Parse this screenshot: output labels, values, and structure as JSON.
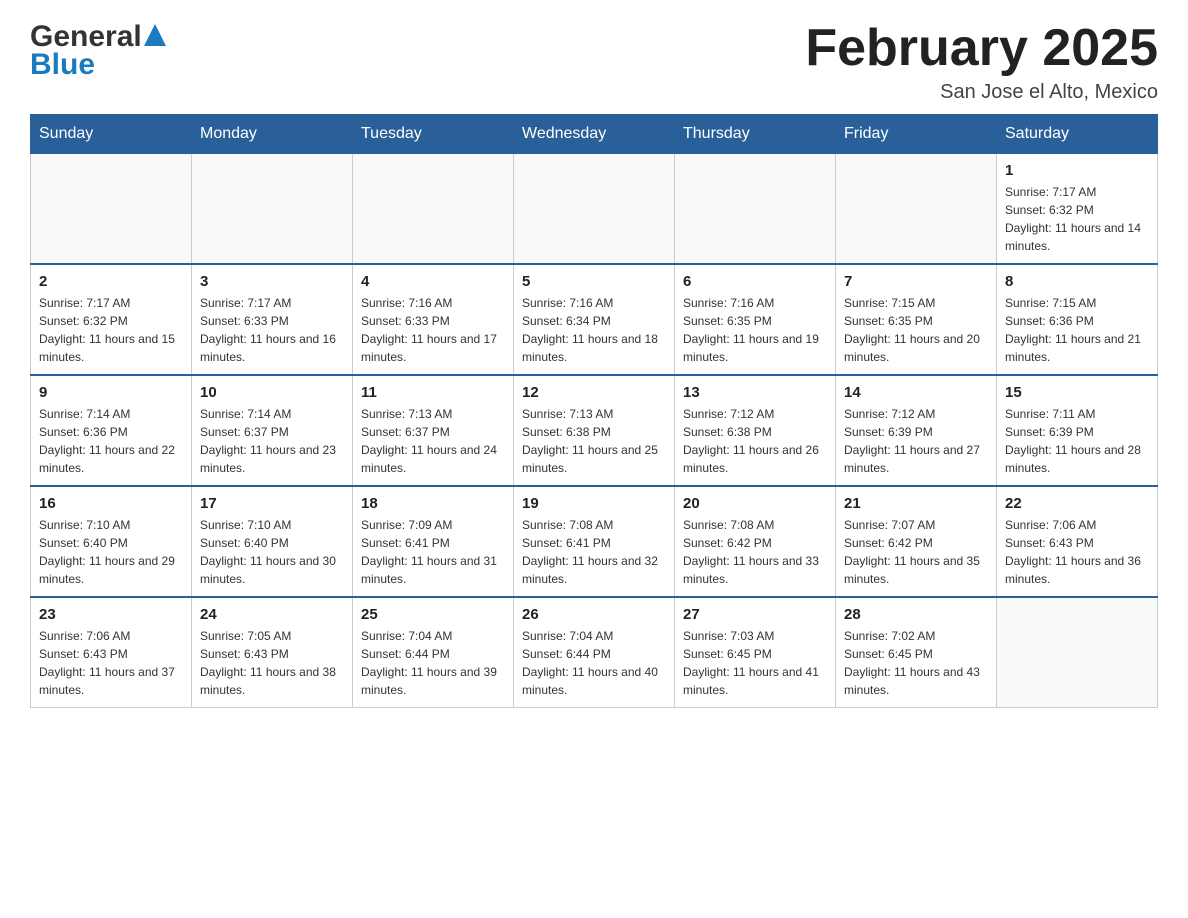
{
  "header": {
    "logo_general": "General",
    "logo_blue": "Blue",
    "month_title": "February 2025",
    "location": "San Jose el Alto, Mexico"
  },
  "weekdays": [
    "Sunday",
    "Monday",
    "Tuesday",
    "Wednesday",
    "Thursday",
    "Friday",
    "Saturday"
  ],
  "weeks": [
    [
      {
        "day": "",
        "sunrise": "",
        "sunset": "",
        "daylight": ""
      },
      {
        "day": "",
        "sunrise": "",
        "sunset": "",
        "daylight": ""
      },
      {
        "day": "",
        "sunrise": "",
        "sunset": "",
        "daylight": ""
      },
      {
        "day": "",
        "sunrise": "",
        "sunset": "",
        "daylight": ""
      },
      {
        "day": "",
        "sunrise": "",
        "sunset": "",
        "daylight": ""
      },
      {
        "day": "",
        "sunrise": "",
        "sunset": "",
        "daylight": ""
      },
      {
        "day": "1",
        "sunrise": "Sunrise: 7:17 AM",
        "sunset": "Sunset: 6:32 PM",
        "daylight": "Daylight: 11 hours and 14 minutes."
      }
    ],
    [
      {
        "day": "2",
        "sunrise": "Sunrise: 7:17 AM",
        "sunset": "Sunset: 6:32 PM",
        "daylight": "Daylight: 11 hours and 15 minutes."
      },
      {
        "day": "3",
        "sunrise": "Sunrise: 7:17 AM",
        "sunset": "Sunset: 6:33 PM",
        "daylight": "Daylight: 11 hours and 16 minutes."
      },
      {
        "day": "4",
        "sunrise": "Sunrise: 7:16 AM",
        "sunset": "Sunset: 6:33 PM",
        "daylight": "Daylight: 11 hours and 17 minutes."
      },
      {
        "day": "5",
        "sunrise": "Sunrise: 7:16 AM",
        "sunset": "Sunset: 6:34 PM",
        "daylight": "Daylight: 11 hours and 18 minutes."
      },
      {
        "day": "6",
        "sunrise": "Sunrise: 7:16 AM",
        "sunset": "Sunset: 6:35 PM",
        "daylight": "Daylight: 11 hours and 19 minutes."
      },
      {
        "day": "7",
        "sunrise": "Sunrise: 7:15 AM",
        "sunset": "Sunset: 6:35 PM",
        "daylight": "Daylight: 11 hours and 20 minutes."
      },
      {
        "day": "8",
        "sunrise": "Sunrise: 7:15 AM",
        "sunset": "Sunset: 6:36 PM",
        "daylight": "Daylight: 11 hours and 21 minutes."
      }
    ],
    [
      {
        "day": "9",
        "sunrise": "Sunrise: 7:14 AM",
        "sunset": "Sunset: 6:36 PM",
        "daylight": "Daylight: 11 hours and 22 minutes."
      },
      {
        "day": "10",
        "sunrise": "Sunrise: 7:14 AM",
        "sunset": "Sunset: 6:37 PM",
        "daylight": "Daylight: 11 hours and 23 minutes."
      },
      {
        "day": "11",
        "sunrise": "Sunrise: 7:13 AM",
        "sunset": "Sunset: 6:37 PM",
        "daylight": "Daylight: 11 hours and 24 minutes."
      },
      {
        "day": "12",
        "sunrise": "Sunrise: 7:13 AM",
        "sunset": "Sunset: 6:38 PM",
        "daylight": "Daylight: 11 hours and 25 minutes."
      },
      {
        "day": "13",
        "sunrise": "Sunrise: 7:12 AM",
        "sunset": "Sunset: 6:38 PM",
        "daylight": "Daylight: 11 hours and 26 minutes."
      },
      {
        "day": "14",
        "sunrise": "Sunrise: 7:12 AM",
        "sunset": "Sunset: 6:39 PM",
        "daylight": "Daylight: 11 hours and 27 minutes."
      },
      {
        "day": "15",
        "sunrise": "Sunrise: 7:11 AM",
        "sunset": "Sunset: 6:39 PM",
        "daylight": "Daylight: 11 hours and 28 minutes."
      }
    ],
    [
      {
        "day": "16",
        "sunrise": "Sunrise: 7:10 AM",
        "sunset": "Sunset: 6:40 PM",
        "daylight": "Daylight: 11 hours and 29 minutes."
      },
      {
        "day": "17",
        "sunrise": "Sunrise: 7:10 AM",
        "sunset": "Sunset: 6:40 PM",
        "daylight": "Daylight: 11 hours and 30 minutes."
      },
      {
        "day": "18",
        "sunrise": "Sunrise: 7:09 AM",
        "sunset": "Sunset: 6:41 PM",
        "daylight": "Daylight: 11 hours and 31 minutes."
      },
      {
        "day": "19",
        "sunrise": "Sunrise: 7:08 AM",
        "sunset": "Sunset: 6:41 PM",
        "daylight": "Daylight: 11 hours and 32 minutes."
      },
      {
        "day": "20",
        "sunrise": "Sunrise: 7:08 AM",
        "sunset": "Sunset: 6:42 PM",
        "daylight": "Daylight: 11 hours and 33 minutes."
      },
      {
        "day": "21",
        "sunrise": "Sunrise: 7:07 AM",
        "sunset": "Sunset: 6:42 PM",
        "daylight": "Daylight: 11 hours and 35 minutes."
      },
      {
        "day": "22",
        "sunrise": "Sunrise: 7:06 AM",
        "sunset": "Sunset: 6:43 PM",
        "daylight": "Daylight: 11 hours and 36 minutes."
      }
    ],
    [
      {
        "day": "23",
        "sunrise": "Sunrise: 7:06 AM",
        "sunset": "Sunset: 6:43 PM",
        "daylight": "Daylight: 11 hours and 37 minutes."
      },
      {
        "day": "24",
        "sunrise": "Sunrise: 7:05 AM",
        "sunset": "Sunset: 6:43 PM",
        "daylight": "Daylight: 11 hours and 38 minutes."
      },
      {
        "day": "25",
        "sunrise": "Sunrise: 7:04 AM",
        "sunset": "Sunset: 6:44 PM",
        "daylight": "Daylight: 11 hours and 39 minutes."
      },
      {
        "day": "26",
        "sunrise": "Sunrise: 7:04 AM",
        "sunset": "Sunset: 6:44 PM",
        "daylight": "Daylight: 11 hours and 40 minutes."
      },
      {
        "day": "27",
        "sunrise": "Sunrise: 7:03 AM",
        "sunset": "Sunset: 6:45 PM",
        "daylight": "Daylight: 11 hours and 41 minutes."
      },
      {
        "day": "28",
        "sunrise": "Sunrise: 7:02 AM",
        "sunset": "Sunset: 6:45 PM",
        "daylight": "Daylight: 11 hours and 43 minutes."
      },
      {
        "day": "",
        "sunrise": "",
        "sunset": "",
        "daylight": ""
      }
    ]
  ]
}
